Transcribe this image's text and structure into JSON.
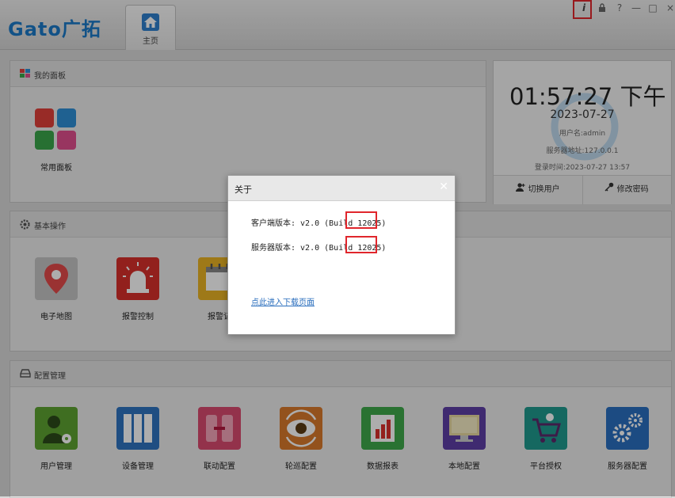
{
  "app": {
    "logo": "Gato广拓"
  },
  "home_tab": {
    "label": "主页"
  },
  "window_controls": {
    "info": "i",
    "help": "?",
    "minimize": "—",
    "maximize": "□",
    "close": "×"
  },
  "panels": {
    "my_panel": {
      "title": "我的面板",
      "tiles": [
        {
          "label": "常用面板"
        }
      ]
    },
    "basic": {
      "title": "基本操作",
      "tiles": [
        {
          "label": "电子地图"
        },
        {
          "label": "报警控制"
        },
        {
          "label": "报警记"
        }
      ]
    },
    "config": {
      "title": "配置管理",
      "tiles": [
        {
          "label": "用户管理"
        },
        {
          "label": "设备管理"
        },
        {
          "label": "联动配置"
        },
        {
          "label": "轮巡配置"
        },
        {
          "label": "数据报表"
        },
        {
          "label": "本地配置"
        },
        {
          "label": "平台授权"
        },
        {
          "label": "服务器配置"
        }
      ]
    }
  },
  "clock": {
    "time": "01:57:27 下午",
    "date": "2023-07-27",
    "username_label": "用户名:",
    "username": "admin",
    "server_label": "服务器地址:",
    "server": "127.0.0.1",
    "login_label": "登录时间:",
    "login_time": "2023-07-27 13:57",
    "switch_user": "切换用户",
    "change_password": "修改密码"
  },
  "about_dialog": {
    "title": "关于",
    "client_prefix": "客户端版本: v2.0 (Build ",
    "client_build": "12025)",
    "server_prefix": "服务器版本: v2.0 (Build ",
    "server_build": "12025)",
    "link": "点此进入下载页面"
  }
}
